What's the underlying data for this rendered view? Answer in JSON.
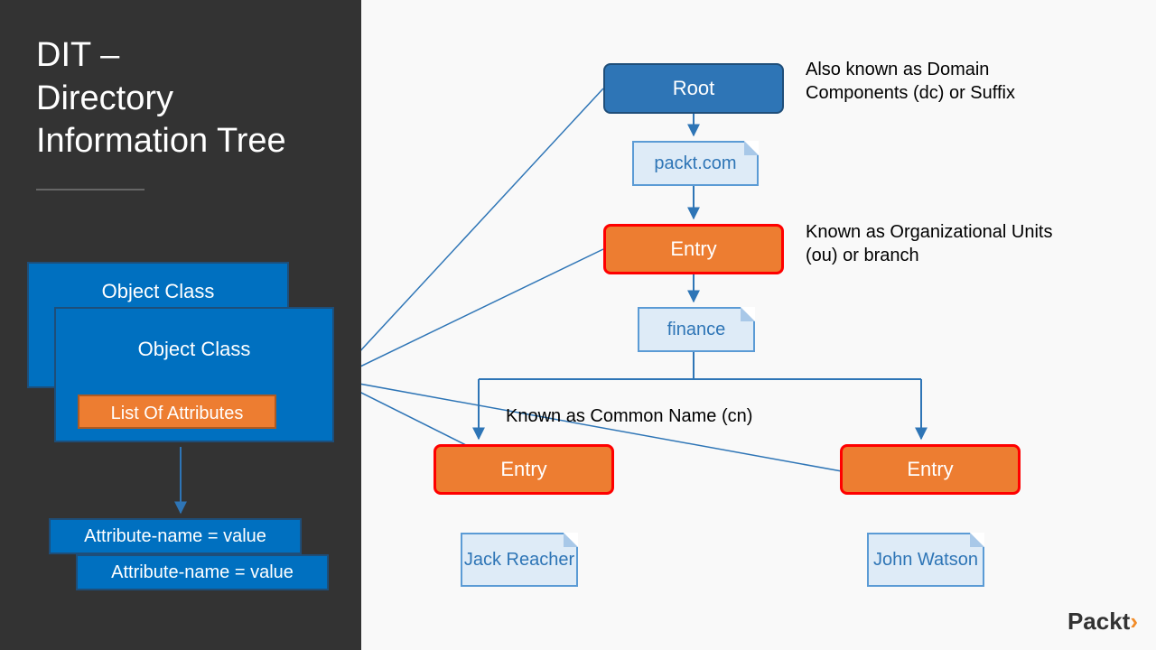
{
  "title_line1": "DIT –",
  "title_line2": "Directory",
  "title_line3": "Information Tree",
  "object_class_back": "Object Class",
  "object_class_front": "Object Class",
  "list_of_attributes": "List Of Attributes",
  "attr1": "Attribute-name = value",
  "attr2": "Attribute-name = value",
  "nodes": {
    "root": "Root",
    "packt": "packt.com",
    "entry_mid": "Entry",
    "finance": "finance",
    "entry_left": "Entry",
    "entry_right": "Entry",
    "jack": "Jack Reacher",
    "john": "John Watson"
  },
  "annotations": {
    "root": "Also known as Domain Components (dc) or Suffix",
    "entry": "Known as Organizational Units (ou) or branch",
    "leaf": "Known as Common Name (cn)"
  },
  "brand": {
    "name": "Packt",
    "symbol": "›"
  }
}
